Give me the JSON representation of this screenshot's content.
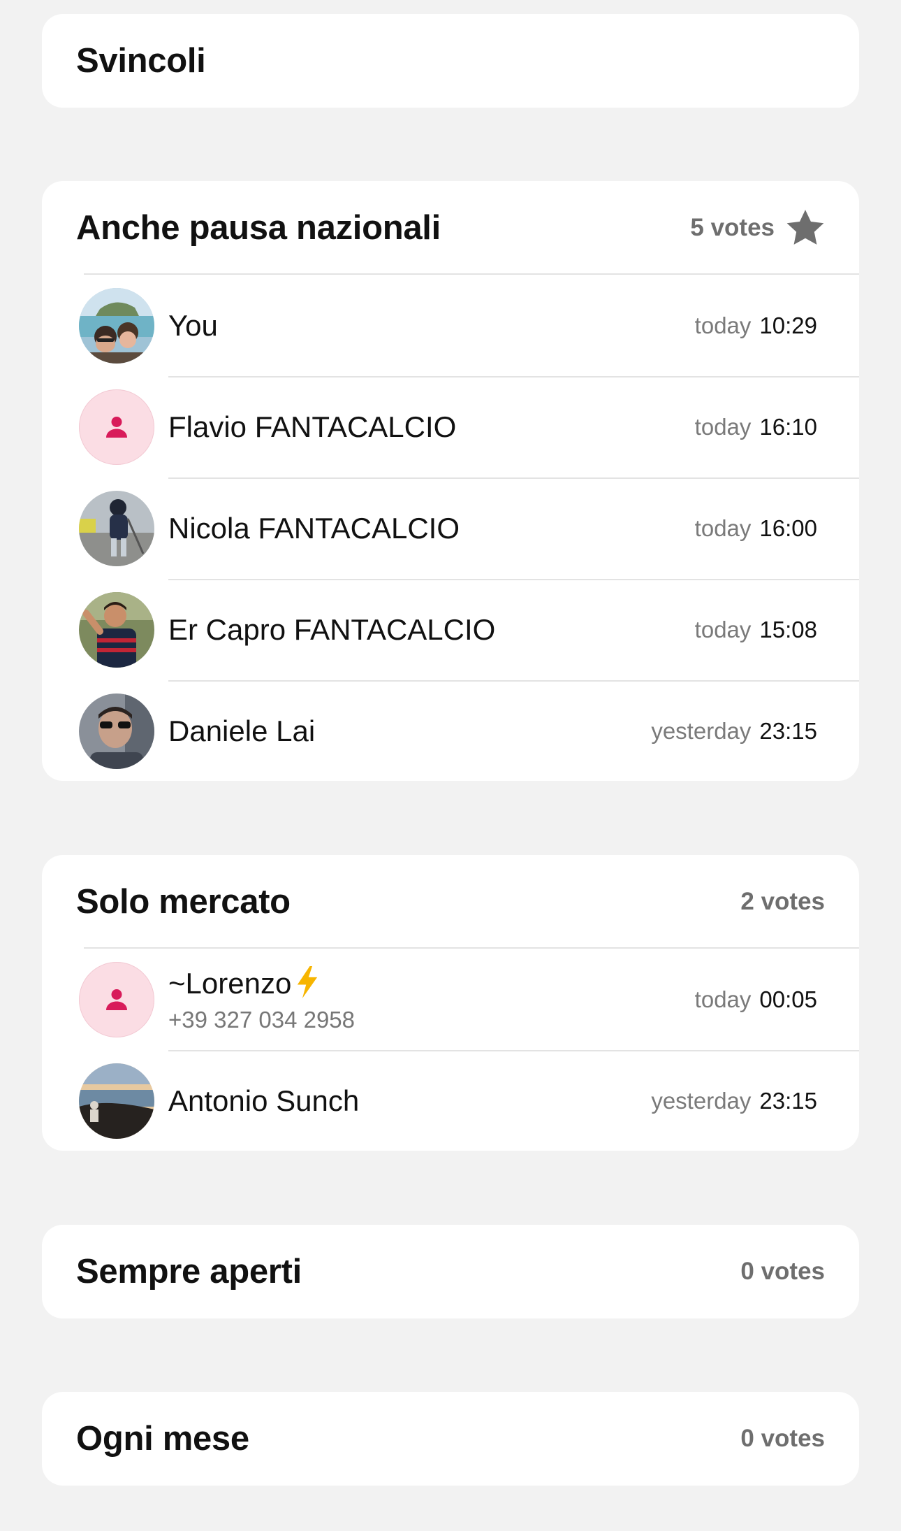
{
  "options": [
    {
      "title": "Svincoli",
      "votes": "",
      "voters": []
    },
    {
      "title": "Anche pausa nazionali",
      "votes": "5 votes",
      "star_icon": "star-icon",
      "voters": [
        {
          "name": "You",
          "day": "today",
          "time": "10:29",
          "avatar": "photo"
        },
        {
          "name": "Flavio FANTACALCIO",
          "day": "today",
          "time": "16:10",
          "avatar": "person-icon"
        },
        {
          "name": "Nicola FANTACALCIO",
          "day": "today",
          "time": "16:00",
          "avatar": "photo"
        },
        {
          "name": "Er Capro FANTACALCIO",
          "day": "today",
          "time": "15:08",
          "avatar": "photo"
        },
        {
          "name": "Daniele Lai",
          "day": "yesterday",
          "time": "23:15",
          "avatar": "photo"
        }
      ]
    },
    {
      "title": "Solo mercato",
      "votes": "2 votes",
      "voters": [
        {
          "name": "~Lorenzo",
          "emoji": "lightning-icon",
          "phone": "+39 327 034 2958",
          "day": "today",
          "time": "00:05",
          "avatar": "person-icon"
        },
        {
          "name": "Antonio Sunch",
          "day": "yesterday",
          "time": "23:15",
          "avatar": "photo"
        }
      ]
    },
    {
      "title": "Sempre aperti",
      "votes": "0 votes",
      "voters": []
    },
    {
      "title": "Ogni mese",
      "votes": "0 votes",
      "voters": []
    }
  ],
  "colors": {
    "background": "#f2f2f2",
    "card": "#ffffff",
    "placeholder_avatar_bg": "#fbdde4",
    "placeholder_avatar_icon": "#d81b5a",
    "votes_text": "#6e6e6e",
    "bolt": "#f7b500"
  }
}
